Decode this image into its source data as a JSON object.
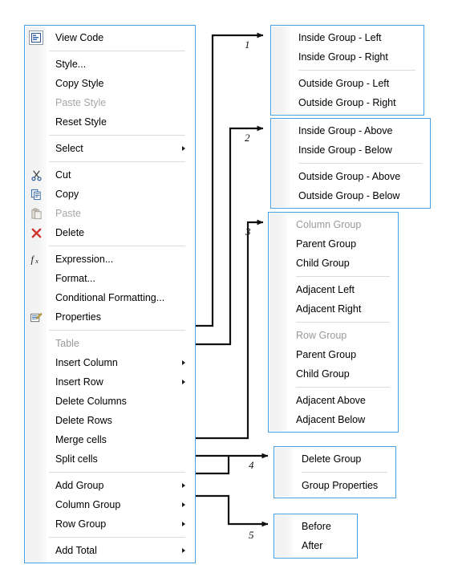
{
  "colors": {
    "menu_border": "#4a9fe0",
    "gutter": "#f1f1f1",
    "separator": "#dcdcdc",
    "text": "#000000",
    "text_disabled": "#a6a6a6",
    "text_header": "#9a9a9a",
    "wire": "#111111"
  },
  "main_menu": {
    "name": "report-designer-context-menu",
    "items": [
      {
        "label": "View Code",
        "icon": "view-code-icon",
        "state": "normal",
        "submenu": false
      },
      {
        "type": "separator"
      },
      {
        "label": "Style...",
        "icon": "",
        "state": "normal",
        "submenu": false
      },
      {
        "label": "Copy Style",
        "icon": "",
        "state": "normal",
        "submenu": false
      },
      {
        "label": "Paste Style",
        "icon": "",
        "state": "disabled",
        "submenu": false
      },
      {
        "label": "Reset Style",
        "icon": "",
        "state": "normal",
        "submenu": false
      },
      {
        "type": "separator"
      },
      {
        "label": "Select",
        "icon": "",
        "state": "normal",
        "submenu": true
      },
      {
        "type": "separator"
      },
      {
        "label": "Cut",
        "icon": "scissors-icon",
        "state": "normal",
        "submenu": false
      },
      {
        "label": "Copy",
        "icon": "copy-icon",
        "state": "normal",
        "submenu": false
      },
      {
        "label": "Paste",
        "icon": "paste-icon",
        "state": "disabled",
        "submenu": false
      },
      {
        "label": "Delete",
        "icon": "delete-x-icon",
        "state": "normal",
        "submenu": false
      },
      {
        "type": "separator"
      },
      {
        "label": "Expression...",
        "icon": "function-fx-icon",
        "state": "normal",
        "submenu": false
      },
      {
        "label": "Format...",
        "icon": "",
        "state": "normal",
        "submenu": false
      },
      {
        "label": "Conditional Formatting...",
        "icon": "",
        "state": "normal",
        "submenu": false
      },
      {
        "label": "Properties",
        "icon": "properties-icon",
        "state": "normal",
        "submenu": false
      },
      {
        "type": "separator"
      },
      {
        "label": "Table",
        "icon": "",
        "state": "header",
        "submenu": false
      },
      {
        "label": "Insert Column",
        "icon": "",
        "state": "normal",
        "submenu": true
      },
      {
        "label": "Insert Row",
        "icon": "",
        "state": "normal",
        "submenu": true
      },
      {
        "label": "Delete Columns",
        "icon": "",
        "state": "normal",
        "submenu": false
      },
      {
        "label": "Delete Rows",
        "icon": "",
        "state": "normal",
        "submenu": false
      },
      {
        "label": "Merge cells",
        "icon": "",
        "state": "normal",
        "submenu": false
      },
      {
        "label": "Split cells",
        "icon": "",
        "state": "normal",
        "submenu": false
      },
      {
        "type": "separator"
      },
      {
        "label": "Add Group",
        "icon": "",
        "state": "normal",
        "submenu": true
      },
      {
        "label": "Column Group",
        "icon": "",
        "state": "normal",
        "submenu": true
      },
      {
        "label": "Row Group",
        "icon": "",
        "state": "normal",
        "submenu": true
      },
      {
        "type": "separator"
      },
      {
        "label": "Add Total",
        "icon": "",
        "state": "normal",
        "submenu": true
      }
    ]
  },
  "submenus": [
    {
      "id": 1,
      "number": "1",
      "name": "insert-column-submenu",
      "items": [
        {
          "label": "Inside Group - Left",
          "state": "normal"
        },
        {
          "label": "Inside Group - Right",
          "state": "normal"
        },
        {
          "type": "separator"
        },
        {
          "label": "Outside Group - Left",
          "state": "normal"
        },
        {
          "label": "Outside Group - Right",
          "state": "normal"
        }
      ]
    },
    {
      "id": 2,
      "number": "2",
      "name": "insert-row-submenu",
      "items": [
        {
          "label": "Inside Group - Above",
          "state": "normal"
        },
        {
          "label": "Inside Group - Below",
          "state": "normal"
        },
        {
          "type": "separator"
        },
        {
          "label": "Outside Group - Above",
          "state": "normal"
        },
        {
          "label": "Outside Group - Below",
          "state": "normal"
        }
      ]
    },
    {
      "id": 3,
      "number": "3",
      "name": "add-group-submenu",
      "items": [
        {
          "label": "Column Group",
          "state": "header"
        },
        {
          "label": "Parent Group",
          "state": "normal"
        },
        {
          "label": "Child Group",
          "state": "normal"
        },
        {
          "type": "separator"
        },
        {
          "label": "Adjacent Left",
          "state": "normal"
        },
        {
          "label": "Adjacent Right",
          "state": "normal"
        },
        {
          "type": "separator"
        },
        {
          "label": "Row Group",
          "state": "header"
        },
        {
          "label": "Parent Group",
          "state": "normal"
        },
        {
          "label": "Child Group",
          "state": "normal"
        },
        {
          "type": "separator"
        },
        {
          "label": "Adjacent Above",
          "state": "normal"
        },
        {
          "label": "Adjacent Below",
          "state": "normal"
        }
      ]
    },
    {
      "id": 4,
      "number": "4",
      "name": "group-submenu",
      "items": [
        {
          "label": "Delete Group",
          "state": "normal"
        },
        {
          "type": "separator"
        },
        {
          "label": "Group Properties",
          "state": "normal"
        }
      ]
    },
    {
      "id": 5,
      "number": "5",
      "name": "add-total-submenu",
      "items": [
        {
          "label": "Before",
          "state": "normal"
        },
        {
          "label": "After",
          "state": "normal"
        }
      ]
    }
  ]
}
